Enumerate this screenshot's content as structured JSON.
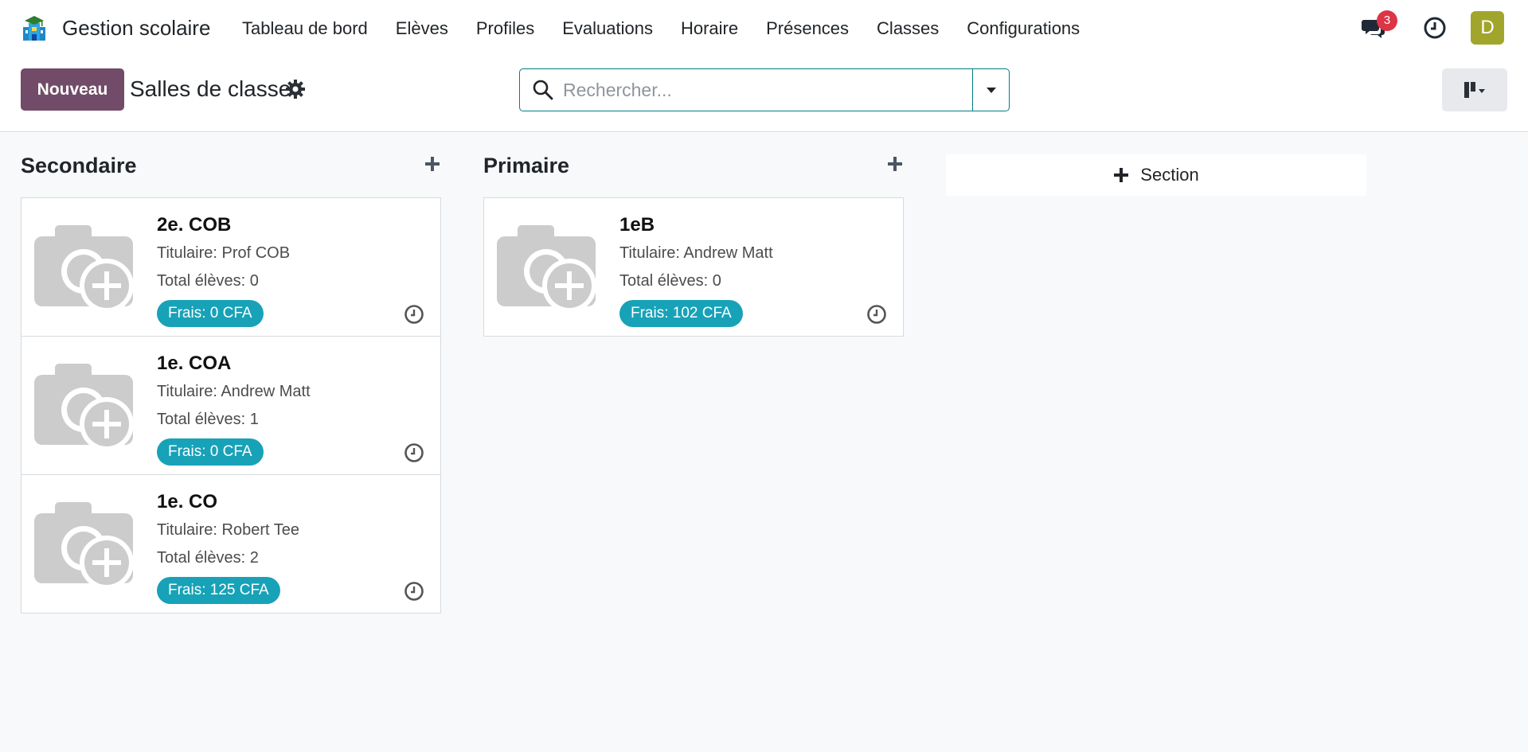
{
  "app": {
    "name": "Gestion scolaire",
    "logo_icon": "school-building-icon"
  },
  "menu": [
    {
      "label": "Tableau de bord"
    },
    {
      "label": "Elèves"
    },
    {
      "label": "Profiles"
    },
    {
      "label": "Evaluations"
    },
    {
      "label": "Horaire"
    },
    {
      "label": "Présences"
    },
    {
      "label": "Classes"
    },
    {
      "label": "Configurations"
    }
  ],
  "systray": {
    "messages_count": "3",
    "avatar_letter": "D",
    "avatar_color": "#a2a52b",
    "badge_color": "#dc3545"
  },
  "control": {
    "new_label": "Nouveau",
    "title": "Salles de classe",
    "search_placeholder": "Rechercher...",
    "new_color": "#714b67"
  },
  "columns": [
    {
      "title": "Secondaire",
      "cards": [
        {
          "name": "2e. COB",
          "teacher": "Titulaire: Prof COB",
          "students": "Total élèves: 0",
          "fee": "Frais: 0 CFA"
        },
        {
          "name": "1e. COA",
          "teacher": "Titulaire: Andrew Matt",
          "students": "Total élèves: 1",
          "fee": "Frais: 0 CFA"
        },
        {
          "name": "1e. CO",
          "teacher": "Titulaire: Robert Tee",
          "students": "Total élèves: 2",
          "fee": "Frais: 125 CFA"
        }
      ]
    },
    {
      "title": "Primaire",
      "cards": [
        {
          "name": "1eB",
          "teacher": "Titulaire: Andrew Matt",
          "students": "Total élèves: 0",
          "fee": "Frais: 102 CFA"
        }
      ]
    }
  ],
  "add_section_label": "Section",
  "fee_badge_color": "#17a2b8"
}
